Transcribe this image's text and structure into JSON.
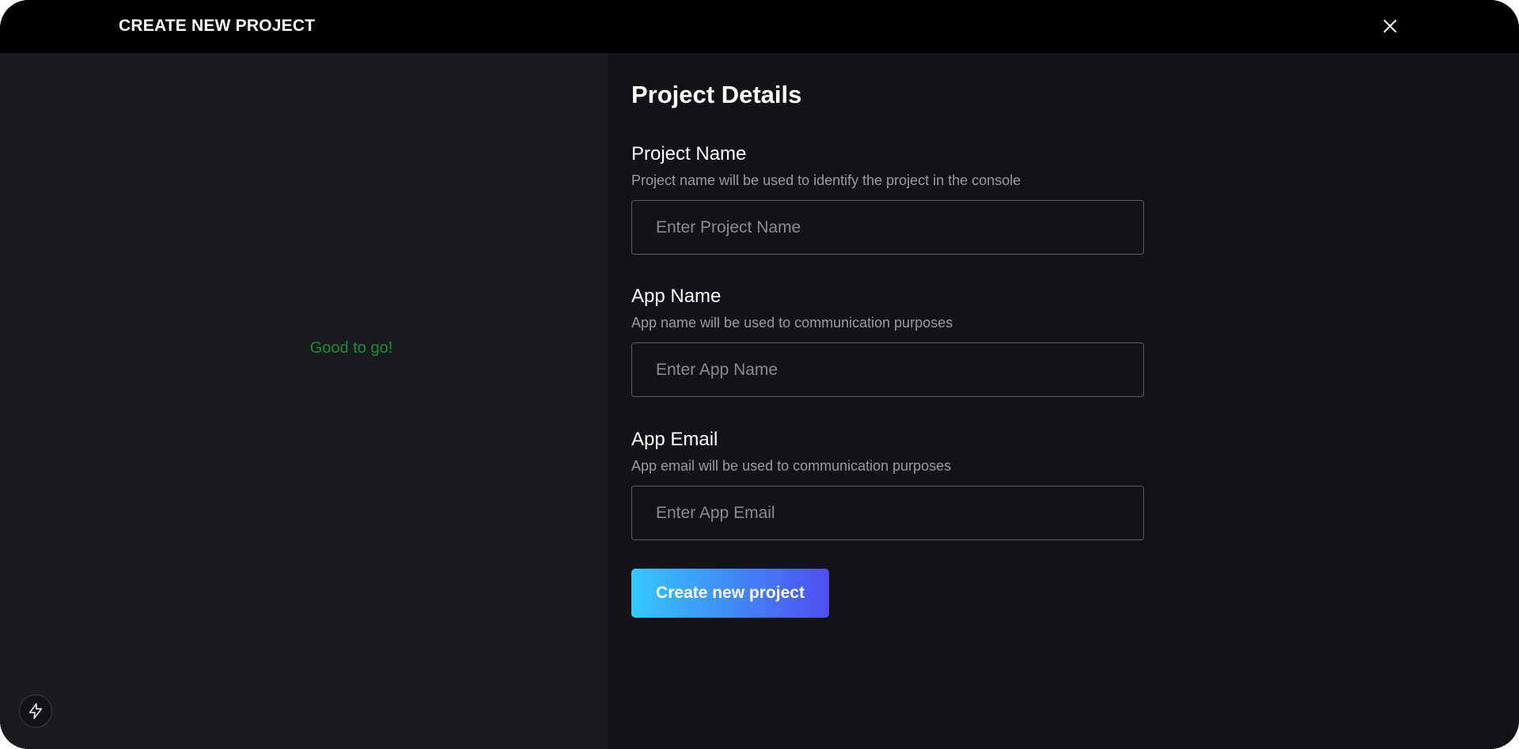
{
  "header": {
    "title": "CREATE NEW PROJECT",
    "close_icon": "close-icon"
  },
  "left_panel": {
    "status_text": "Good to go!",
    "status_color": "#1f8a37",
    "floating_icon": "lightning-bolt-icon"
  },
  "form": {
    "title": "Project Details",
    "fields": [
      {
        "label": "Project Name",
        "help": "Project name will be used to identify the project in the console",
        "placeholder": "Enter Project Name",
        "value": ""
      },
      {
        "label": "App Name",
        "help": "App name will be used to communication purposes",
        "placeholder": "Enter App Name",
        "value": ""
      },
      {
        "label": "App Email",
        "help": "App email will be used to communication purposes",
        "placeholder": "Enter App Email",
        "value": ""
      }
    ],
    "submit_label": "Create new project"
  },
  "colors": {
    "background": "#121317",
    "header": "#000000",
    "left_panel": "#1a1b1f",
    "accent_gradient_start": "#35c8fb",
    "accent_gradient_end": "#4e4ef0"
  }
}
